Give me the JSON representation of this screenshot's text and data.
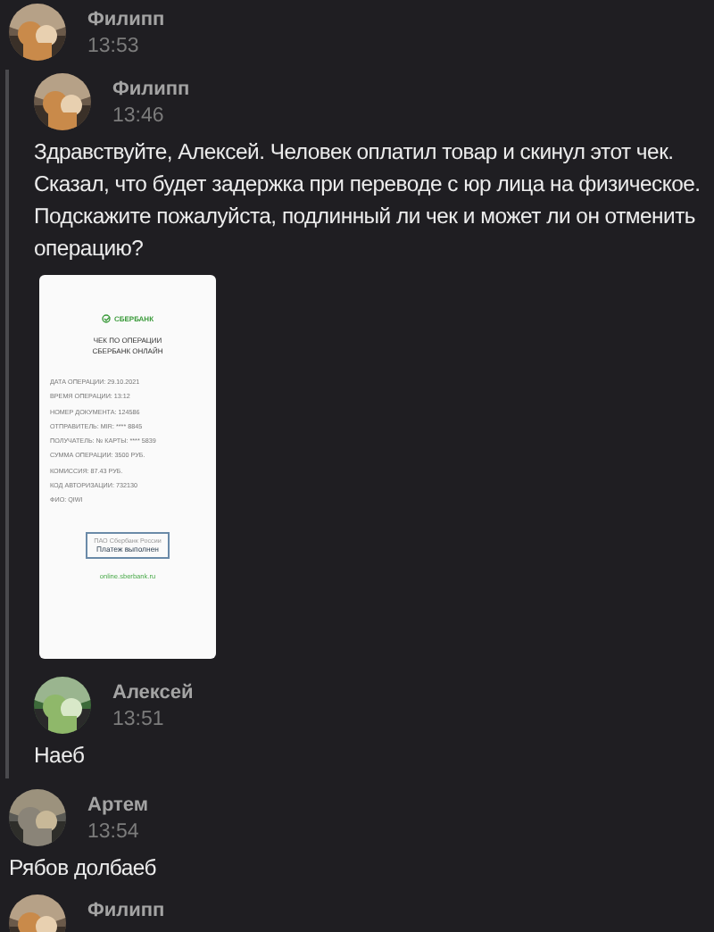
{
  "messages": [
    {
      "author": "Филипп",
      "time": "13:53",
      "forwarded": [
        {
          "author": "Филипп",
          "time": "13:46",
          "text": "Здравствуйте, Алексей. Человек оплатил товар и скинул этот чек. Сказал, что будет задержка при переводе с юр лица на физическое. Подскажите пожалуйста, подлинный ли чек и может ли он отменить операцию?",
          "attachment": {
            "kind": "receipt",
            "bank": "СБЕРБАНК",
            "title_lines": [
              "ЧЕК ПО ОПЕРАЦИИ",
              "СБЕРБАНК ОНЛАЙН"
            ],
            "fields": [
              "ДАТА ОПЕРАЦИИ: 29.10.2021",
              "ВРЕМЯ ОПЕРАЦИИ: 13:12",
              "НОМЕР ДОКУМЕНТА: 124586",
              "ОТПРАВИТЕЛЬ: MIR: **** 8845",
              "ПОЛУЧАТЕЛЬ: № КАРТЫ: **** 5839",
              "СУММА ОПЕРАЦИИ: 3500 РУБ.",
              "КОМИССИЯ: 87.43 РУБ.",
              "КОД АВТОРИЗАЦИИ: 732130",
              "ФИО: QIWI"
            ],
            "stamp_caption": "ПАО Сбербанк России",
            "stamp": "Платеж выполнен",
            "link": "online.sberbank.ru"
          }
        },
        {
          "author": "Алексей",
          "time": "13:51",
          "text": "Наеб"
        }
      ]
    },
    {
      "author": "Артем",
      "time": "13:54",
      "text": "Рябов долбаеб"
    },
    {
      "author": "Филипп"
    }
  ]
}
